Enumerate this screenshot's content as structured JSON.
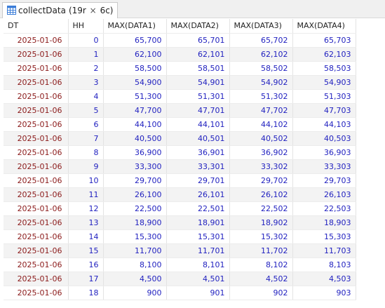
{
  "tab": {
    "title": "collectData",
    "meta_open": "(19r",
    "meta_times": "×",
    "meta_close": "6c)"
  },
  "colors": {
    "date_text": "#8b1a1a",
    "number_text": "#1f1fbf",
    "striped_row": "#f3f3f3"
  },
  "icons": {
    "tab": "table-icon"
  },
  "table": {
    "headers": [
      "DT",
      "HH",
      "MAX(DATA1)",
      "MAX(DATA2)",
      "MAX(DATA3)",
      "MAX(DATA4)"
    ],
    "rows": [
      [
        "2025-01-06",
        "0",
        "65,700",
        "65,701",
        "65,702",
        "65,703"
      ],
      [
        "2025-01-06",
        "1",
        "62,100",
        "62,101",
        "62,102",
        "62,103"
      ],
      [
        "2025-01-06",
        "2",
        "58,500",
        "58,501",
        "58,502",
        "58,503"
      ],
      [
        "2025-01-06",
        "3",
        "54,900",
        "54,901",
        "54,902",
        "54,903"
      ],
      [
        "2025-01-06",
        "4",
        "51,300",
        "51,301",
        "51,302",
        "51,303"
      ],
      [
        "2025-01-06",
        "5",
        "47,700",
        "47,701",
        "47,702",
        "47,703"
      ],
      [
        "2025-01-06",
        "6",
        "44,100",
        "44,101",
        "44,102",
        "44,103"
      ],
      [
        "2025-01-06",
        "7",
        "40,500",
        "40,501",
        "40,502",
        "40,503"
      ],
      [
        "2025-01-06",
        "8",
        "36,900",
        "36,901",
        "36,902",
        "36,903"
      ],
      [
        "2025-01-06",
        "9",
        "33,300",
        "33,301",
        "33,302",
        "33,303"
      ],
      [
        "2025-01-06",
        "10",
        "29,700",
        "29,701",
        "29,702",
        "29,703"
      ],
      [
        "2025-01-06",
        "11",
        "26,100",
        "26,101",
        "26,102",
        "26,103"
      ],
      [
        "2025-01-06",
        "12",
        "22,500",
        "22,501",
        "22,502",
        "22,503"
      ],
      [
        "2025-01-06",
        "13",
        "18,900",
        "18,901",
        "18,902",
        "18,903"
      ],
      [
        "2025-01-06",
        "14",
        "15,300",
        "15,301",
        "15,302",
        "15,303"
      ],
      [
        "2025-01-06",
        "15",
        "11,700",
        "11,701",
        "11,702",
        "11,703"
      ],
      [
        "2025-01-06",
        "16",
        "8,100",
        "8,101",
        "8,102",
        "8,103"
      ],
      [
        "2025-01-06",
        "17",
        "4,500",
        "4,501",
        "4,502",
        "4,503"
      ],
      [
        "2025-01-06",
        "18",
        "900",
        "901",
        "902",
        "903"
      ]
    ]
  }
}
